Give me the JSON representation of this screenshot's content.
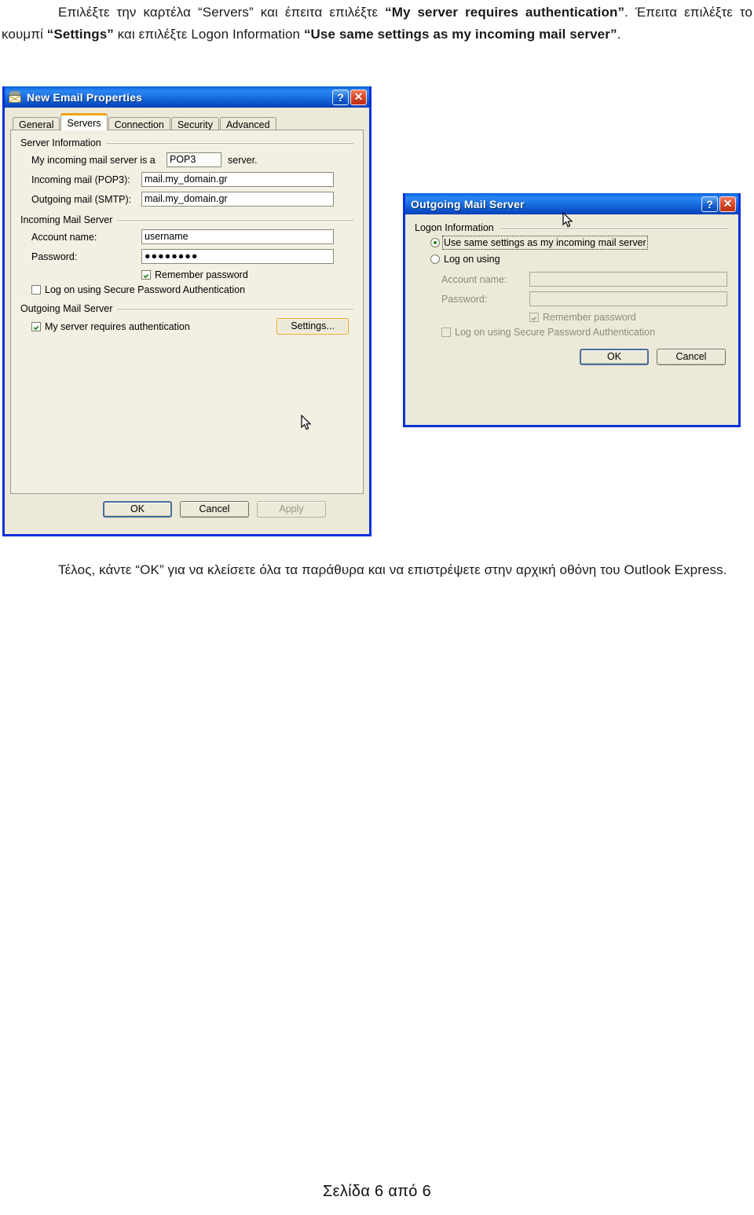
{
  "document": {
    "paragraph_top_html": "Επιλέξτε την καρτέλα “Servers” και έπειτα επιλέξτε <b>“My server requires authentication”</b>. Έπειτα επιλέξτε το κουμπί <b>“Settings”</b> και επιλέξτε Logon Information <b>“Use same settings as my incoming mail server”</b>.",
    "paragraph_bottom_html": "Τέλος, κάντε “OK” για να κλείσετε όλα τα παράθυρα και να επιστρέψετε στην αρχική οθόνη του Outlook Express.",
    "page_footer": "Σελίδα 6 από 6"
  },
  "colors": {
    "title_bar_blue": "#1471e8",
    "dialog_border_blue": "#0831d9",
    "dialog_face": "#ece9d8",
    "active_tab_accent": "#f0a419",
    "check_green": "#3a8f2e",
    "radio_green": "#2f8a20",
    "close_button_red": "#e04726"
  },
  "dialog1": {
    "title": "New Email Properties",
    "icon": "mail-properties-icon",
    "help_button": "?",
    "close_button": "✕",
    "tabs": [
      {
        "label": "General",
        "active": false
      },
      {
        "label": "Servers",
        "active": true
      },
      {
        "label": "Connection",
        "active": false
      },
      {
        "label": "Security",
        "active": false
      },
      {
        "label": "Advanced",
        "active": false
      }
    ],
    "server_information": {
      "group_label": "Server Information",
      "server_type_prefix": "My incoming mail server is a",
      "server_type_value": "POP3",
      "server_type_suffix": "server.",
      "incoming_label": "Incoming mail (POP3):",
      "incoming_value": "mail.my_domain.gr",
      "outgoing_label": "Outgoing mail (SMTP):",
      "outgoing_value": "mail.my_domain.gr"
    },
    "incoming_mail_server": {
      "group_label": "Incoming Mail Server",
      "account_name_label": "Account name:",
      "account_name_value": "username",
      "password_label": "Password:",
      "password_value": "●●●●●●●●",
      "remember_password_label": "Remember password",
      "remember_password_checked": true,
      "spa_label": "Log on using Secure Password Authentication",
      "spa_checked": false
    },
    "outgoing_mail_server": {
      "group_label": "Outgoing Mail Server",
      "requires_auth_label": "My server requires authentication",
      "requires_auth_checked": true,
      "settings_button": "Settings..."
    },
    "footer": {
      "ok": "OK",
      "cancel": "Cancel",
      "apply": "Apply",
      "apply_disabled": true
    }
  },
  "dialog2": {
    "title": "Outgoing Mail Server",
    "help_button": "?",
    "close_button": "✕",
    "logon_information": {
      "group_label": "Logon Information",
      "option_same_settings": "Use same settings as my incoming mail server",
      "option_log_on_using": "Log on using",
      "selected_option": "Use same settings as my incoming mail server",
      "account_name_label": "Account name:",
      "account_name_value": "",
      "password_label": "Password:",
      "password_value": "",
      "remember_password_label": "Remember password",
      "remember_password_checked": true,
      "spa_label": "Log on using Secure Password Authentication",
      "spa_checked": false
    },
    "footer": {
      "ok": "OK",
      "cancel": "Cancel"
    }
  }
}
